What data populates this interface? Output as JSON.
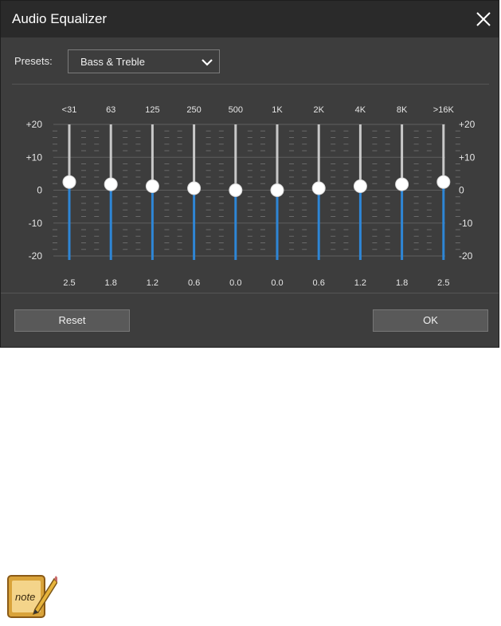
{
  "window": {
    "title": "Audio Equalizer"
  },
  "presets": {
    "label": "Presets:",
    "value": "Bass & Treble"
  },
  "scale": {
    "left_labels": [
      "+20",
      "+10",
      "0",
      "-10",
      "-20"
    ],
    "right_labels": [
      "+20",
      "+10",
      "0",
      "-10",
      "-20"
    ]
  },
  "bands": [
    {
      "freq": "<31",
      "gain": 2.5,
      "gain_label": "2.5"
    },
    {
      "freq": "63",
      "gain": 1.8,
      "gain_label": "1.8"
    },
    {
      "freq": "125",
      "gain": 1.2,
      "gain_label": "1.2"
    },
    {
      "freq": "250",
      "gain": 0.6,
      "gain_label": "0.6"
    },
    {
      "freq": "500",
      "gain": 0.0,
      "gain_label": "0.0"
    },
    {
      "freq": "1K",
      "gain": 0.0,
      "gain_label": "0.0"
    },
    {
      "freq": "2K",
      "gain": 0.6,
      "gain_label": "0.6"
    },
    {
      "freq": "4K",
      "gain": 1.2,
      "gain_label": "1.2"
    },
    {
      "freq": "8K",
      "gain": 1.8,
      "gain_label": "1.8"
    },
    {
      "freq": ">16K",
      "gain": 2.5,
      "gain_label": "2.5"
    }
  ],
  "gain_range": [
    -20,
    20
  ],
  "buttons": {
    "reset": "Reset",
    "ok": "OK"
  },
  "colors": {
    "fill": "#2e86d6",
    "track": "#c8c8c8",
    "thumb": "#ffffff"
  },
  "note": {
    "icon": "note-icon",
    "text": "note"
  }
}
